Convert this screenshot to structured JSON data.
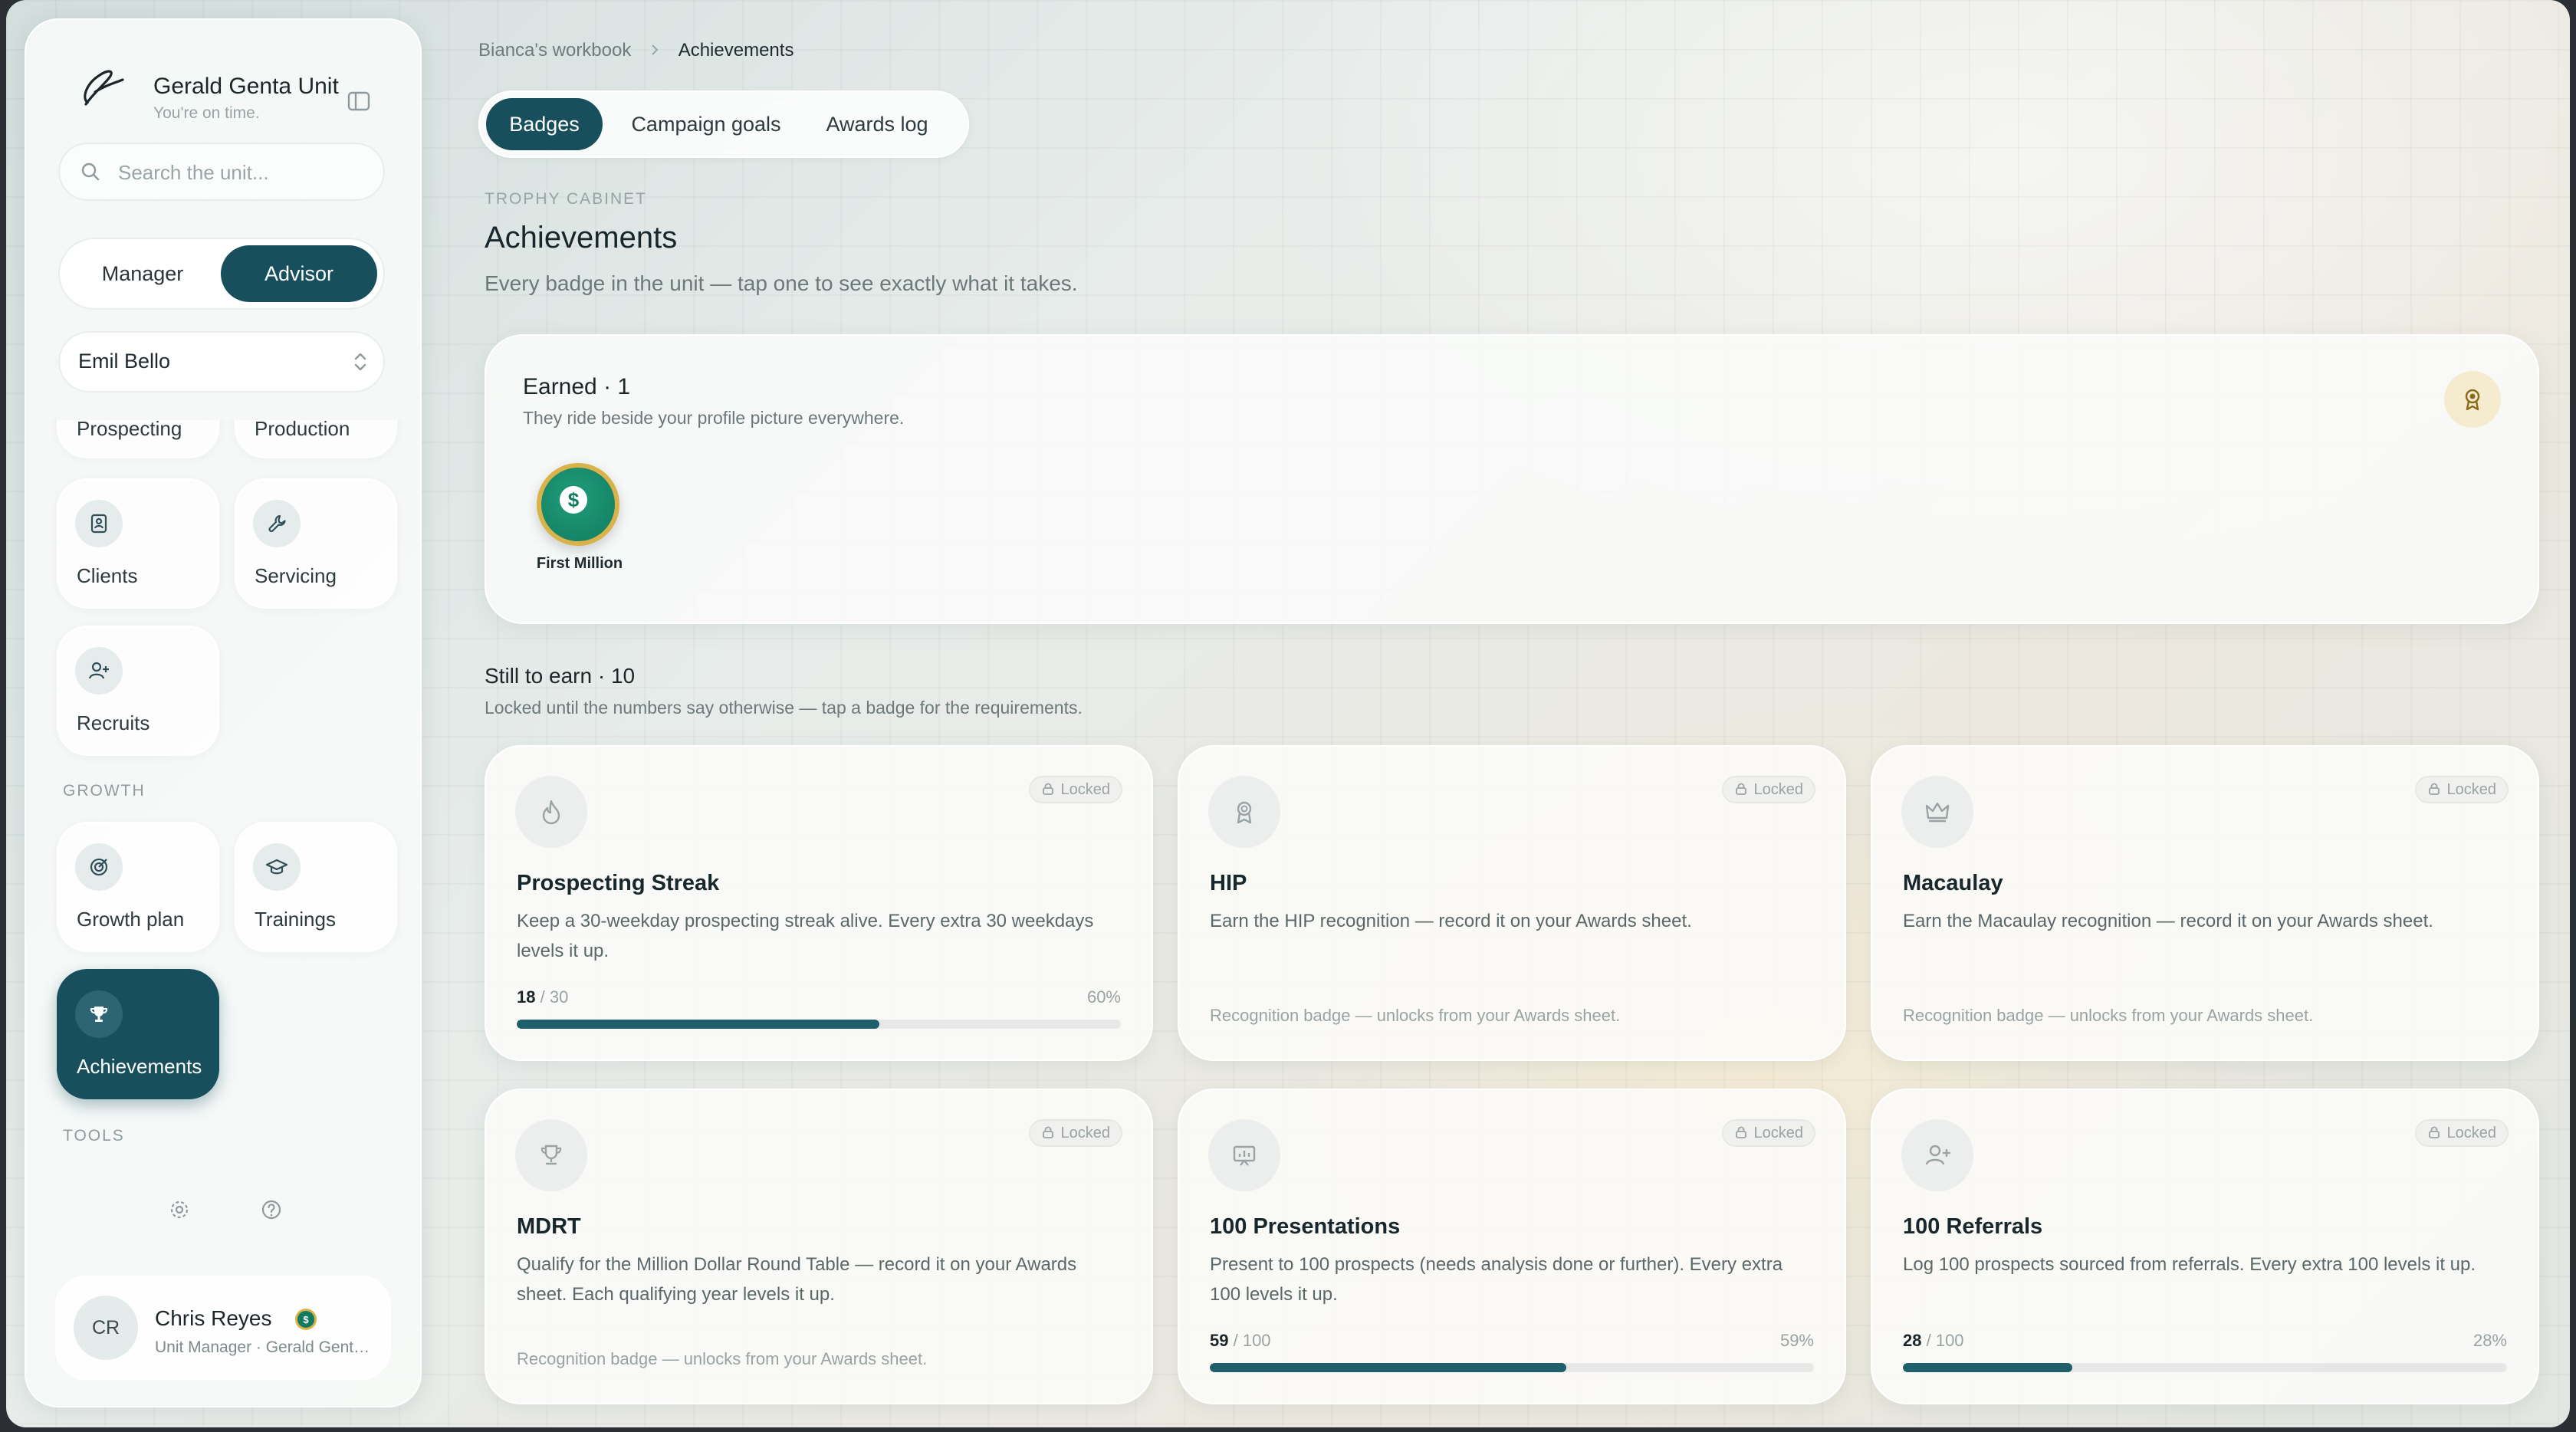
{
  "sidebar": {
    "brand": {
      "name": "Gerald Genta Unit",
      "subtitle": "You're on time."
    },
    "search_placeholder": "Search the unit...",
    "role_toggle": [
      "Manager",
      "Advisor"
    ],
    "member_select": "Emil Bello",
    "nav": {
      "prospecting": "Prospecting",
      "production": "Production",
      "clients": "Clients",
      "servicing": "Servicing",
      "recruits": "Recruits",
      "growth_label": "GROWTH",
      "growth_plan": "Growth plan",
      "trainings": "Trainings",
      "achievements": "Achievements",
      "tools_label": "TOOLS"
    },
    "profile": {
      "initials": "CR",
      "name": "Chris Reyes",
      "role": "Unit Manager · Gerald Genta Unit"
    }
  },
  "breadcrumb": {
    "parent": "Bianca's workbook",
    "current": "Achievements"
  },
  "tabs": [
    "Badges",
    "Campaign goals",
    "Awards log"
  ],
  "header": {
    "eyebrow": "TROPHY CABINET",
    "title": "Achievements",
    "subtitle": "Every badge in the unit — tap one to see exactly what it takes."
  },
  "earned": {
    "title": "Earned · 1",
    "subtitle": "They ride beside your profile picture everywhere.",
    "badge": {
      "symbol": "$",
      "label": "First Million"
    }
  },
  "still": {
    "title": "Still to earn · 10",
    "subtitle": "Locked until the numbers say otherwise — tap a badge for the requirements."
  },
  "cards": [
    {
      "title": "Prospecting Streak",
      "desc": "Keep a 30-weekday prospecting streak alive. Every extra 30 weekdays levels it up.",
      "locked": "Locked",
      "current": "18",
      "total": "/ 30",
      "percent": "60%",
      "progress": 0.6,
      "icon": "flame-icon"
    },
    {
      "title": "HIP",
      "desc": "Earn the HIP recognition — record it on your Awards sheet.",
      "locked": "Locked",
      "footer": "Recognition badge — unlocks from your Awards sheet.",
      "icon": "award-ribbon-icon"
    },
    {
      "title": "Macaulay",
      "desc": "Earn the Macaulay recognition — record it on your Awards sheet.",
      "locked": "Locked",
      "footer": "Recognition badge — unlocks from your Awards sheet.",
      "icon": "crown-icon"
    },
    {
      "title": "MDRT",
      "desc": "Qualify for the Million Dollar Round Table — record it on your Awards sheet. Each qualifying year levels it up.",
      "locked": "Locked",
      "footer": "Recognition badge — unlocks from your Awards sheet.",
      "icon": "trophy-icon"
    },
    {
      "title": "100 Presentations",
      "desc": "Present to 100 prospects (needs analysis done or further). Every extra 100 levels it up.",
      "locked": "Locked",
      "current": "59",
      "total": "/ 100",
      "percent": "59%",
      "progress": 0.59,
      "icon": "presentation-icon"
    },
    {
      "title": "100 Referrals",
      "desc": "Log 100 prospects sourced from referrals. Every extra 100 levels it up.",
      "locked": "Locked",
      "current": "28",
      "total": "/ 100",
      "percent": "28%",
      "progress": 0.28,
      "icon": "user-plus-icon"
    }
  ],
  "colors": {
    "accent": "#184f5c",
    "progress": "#1f5f6c",
    "coin_green": "#127a5f",
    "coin_gold": "#d9b24a"
  }
}
